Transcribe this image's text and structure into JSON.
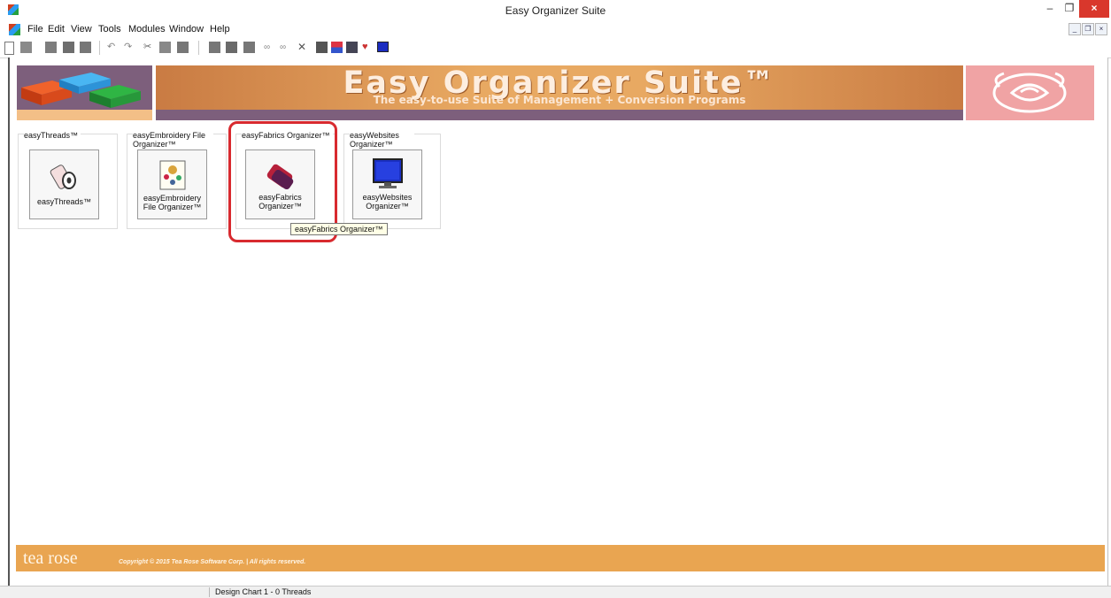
{
  "window": {
    "title": "Easy Organizer Suite",
    "controls": {
      "minimize": "–",
      "restore": "❐",
      "close": "×"
    }
  },
  "menu": {
    "items": [
      "File",
      "Edit",
      "View",
      "Tools",
      "Modules",
      "Window",
      "Help"
    ],
    "mdi_controls": [
      "_",
      "❐",
      "×"
    ]
  },
  "toolbar": {
    "icons": [
      "new-icon",
      "open-icon",
      "save-icon",
      "print-preview-icon",
      "print-icon",
      "undo-icon",
      "redo-icon",
      "cut-icon",
      "copy-icon",
      "paste-icon",
      "module-icon",
      "module-icon",
      "module-icon",
      "link-icon",
      "link-icon",
      "delete-icon",
      "design-icon",
      "design-icon",
      "chart-icon",
      "heart-icon",
      "monitor-icon"
    ]
  },
  "banner": {
    "title": "Easy Organizer Suite™",
    "subtitle": "The easy-to-use Suite of Management + Conversion Programs",
    "colors": {
      "purple": "#7d5f7c",
      "orange": "#e8a962",
      "pink": "#f0a3a4",
      "peach": "#f3bf87"
    }
  },
  "modules": [
    {
      "group_title": "easyThreads™",
      "button_label": "easyThreads™",
      "icon": "thread-spool-icon"
    },
    {
      "group_title": "easyEmbroidery File Organizer™",
      "button_label": "easyEmbroidery File Organizer™",
      "icon": "embroidery-icon"
    },
    {
      "group_title": "easyFabrics Organizer™",
      "button_label": "easyFabrics Organizer™",
      "icon": "fabric-roll-icon"
    },
    {
      "group_title": "easyWebsites Organizer™",
      "button_label": "easyWebsites Organizer™",
      "icon": "monitor-icon"
    }
  ],
  "tooltip": "easyFabrics Organizer™",
  "footer": {
    "logo": "tea rose",
    "copyright": "Copyright © 2015 Tea Rose Software Corp. | All rights reserved."
  },
  "status": {
    "panes": [
      "",
      "Design Chart 1 - 0 Threads"
    ]
  }
}
